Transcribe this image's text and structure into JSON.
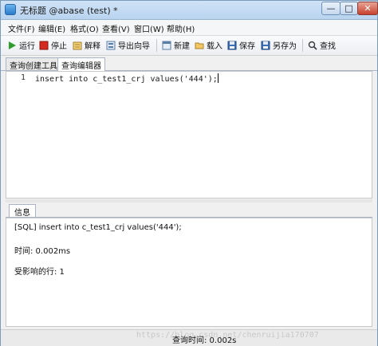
{
  "window": {
    "title": "无标题 @abase (test) *",
    "min_glyph": "—",
    "max_glyph": "□",
    "close_glyph": "✕"
  },
  "menu": {
    "items": [
      "文件(F)",
      "编辑(E)",
      "格式(O)",
      "查看(V)",
      "窗口(W)",
      "帮助(H)"
    ]
  },
  "toolbar": {
    "run": "运行",
    "stop": "停止",
    "explain": "解释",
    "export_wizard": "导出向导",
    "new": "新建",
    "load": "载入",
    "save": "保存",
    "save_as": "另存为",
    "find": "查找",
    "colors": {
      "run": "#2e9d2e",
      "stop": "#d42a1f"
    }
  },
  "tabs": [
    "查询创建工具",
    "查询编辑器"
  ],
  "editor": {
    "line_number": "1",
    "code": "insert into c_test1_crj values('444');"
  },
  "info": {
    "tab_label": "信息",
    "lines": [
      "[SQL] insert into c_test1_crj values('444');",
      "时间: 0.002ms",
      "受影响的行: 1"
    ]
  },
  "status": {
    "query_time": "查询时间: 0.002s",
    "watermark": "https://blog.csdn.net/chenruijia170707"
  }
}
